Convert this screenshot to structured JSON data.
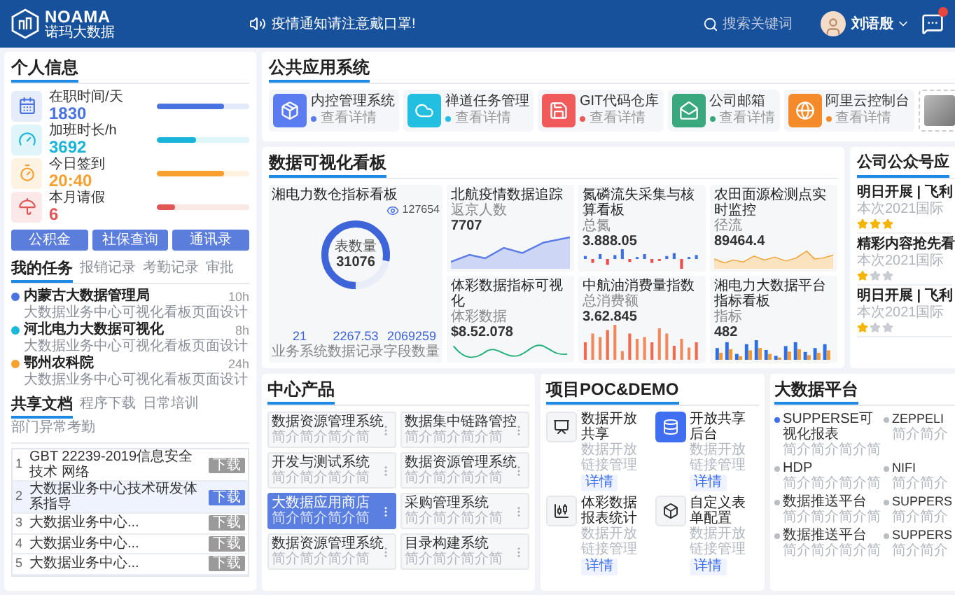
{
  "header": {
    "logo_text": "NOAMA",
    "logo_subtitle": "诺玛大数据",
    "notice": "疫情通知请注意戴口罩!",
    "search": {
      "placeholder": "搜索关键词"
    },
    "user_name": "刘语殷"
  },
  "personal_info": {
    "title": "个人信息",
    "stats": [
      {
        "label": "在职时间/天",
        "value": "1830",
        "level": 0.72,
        "color": "#4a72e0"
      },
      {
        "label": "加班时长/h",
        "value": "3692",
        "level": 0.42,
        "color": "#19b4d8"
      },
      {
        "label": "今日签到",
        "value": "20:40",
        "level": 0.72,
        "color": "#f7a030"
      },
      {
        "label": "本月请假",
        "value": "6",
        "level": 0.2,
        "color": "#e25555"
      }
    ],
    "buttons": [
      "公积金",
      "社保查询",
      "通讯录"
    ]
  },
  "tasks": {
    "tabs": [
      {
        "label": "我的任务",
        "selected": true
      },
      {
        "label": "报销记录",
        "selected": false
      },
      {
        "label": "考勤记录",
        "selected": false
      },
      {
        "label": "审批",
        "selected": false
      }
    ],
    "items": [
      {
        "title": "内蒙古大数据管理局",
        "subtitle": "大数据业务中心可视化看板页面设计",
        "hours": "10h",
        "color": "#4a72e0"
      },
      {
        "title": "河北电力大数据可视化",
        "subtitle": "大数据业务中心可视化看板页面设计",
        "hours": "8h",
        "color": "#19b9db"
      },
      {
        "title": "鄂州农科院",
        "subtitle": "大数据业务中心可视化看板页面设计",
        "hours": "24h",
        "color": "#f7a02c"
      }
    ]
  },
  "docs": {
    "tabs": [
      {
        "label": "共享文档",
        "selected": true
      },
      {
        "label": "程序下载",
        "selected": false
      },
      {
        "label": "日常培训",
        "selected": false
      },
      {
        "label": "部门异常考勤",
        "selected": false
      }
    ],
    "rows": [
      {
        "index": "1",
        "title": "GBT 22239-2019信息安全技术 网络",
        "action": "下载",
        "selected": false
      },
      {
        "index": "2",
        "title": "大数据业务中心技术研发体系指导",
        "action": "下载",
        "selected": true
      },
      {
        "index": "3",
        "title": "大数据业务中心...",
        "action": "下载",
        "selected": false
      },
      {
        "index": "4",
        "title": "大数据业务中心...",
        "action": "下载",
        "selected": false
      },
      {
        "index": "5",
        "title": "大数据业务中心...",
        "action": "下载",
        "selected": false
      }
    ]
  },
  "apps": {
    "title": "公共应用系统",
    "items": [
      {
        "name": "内控管理系统",
        "link": "查看详情",
        "color": "#5b7cf0"
      },
      {
        "name": "禅道任务管理",
        "link": "查看详情",
        "color": "#22bfe0"
      },
      {
        "name": "GIT代码仓库",
        "link": "查看详情",
        "color": "#f05a5a"
      },
      {
        "name": "公司邮箱",
        "link": "查看详情",
        "color": "#3aa87e"
      },
      {
        "name": "阿里云控制台",
        "link": "查看详情",
        "color": "#f58a2a"
      }
    ]
  },
  "board": {
    "title": "数据可视化看板",
    "main_card": {
      "title": "湘电力数仓指标看板",
      "views": "127654",
      "total_label": "表数量",
      "total": "31076",
      "level": 0.78,
      "stats": [
        {
          "value": "21",
          "label": "业务系统"
        },
        {
          "value": "2267.53",
          "label": "数据记录"
        },
        {
          "value": "2069259",
          "label": "字段数量"
        }
      ]
    },
    "cards": [
      {
        "title": "北航疫情数据追踪",
        "metric_label": "返京人数",
        "value": "7707",
        "kind": "area"
      },
      {
        "title": "氮磷流失采集与核算看板",
        "metric_label": "总氮",
        "value": "3.888.05",
        "kind": "split_bars"
      },
      {
        "title": "农田面源检测点实时监控",
        "metric_label": "径流",
        "value": "89464.4",
        "kind": "line"
      },
      {
        "title": "体彩数据指标可视化",
        "metric_label": "体彩数据",
        "value": "$8.52.078",
        "kind": "wave"
      },
      {
        "title": "中航油消费量指数",
        "metric_label": "总消费额",
        "value": "3.62.845",
        "kind": "bars"
      },
      {
        "title": "湘电力大数据平台指标看板",
        "metric_label": "指标",
        "value": "482",
        "kind": "grouped_bars"
      }
    ]
  },
  "notices": {
    "title": "公司公众号应",
    "items": [
      {
        "title": "明日开展 | 飞利",
        "excerpt": "本次2021国际",
        "stars": 3
      },
      {
        "title": "精彩内容抢先看",
        "excerpt": "本次2021国际",
        "stars": 1
      },
      {
        "title": "明日开展 | 飞利",
        "excerpt": "本次2021国际",
        "stars": 1
      }
    ]
  },
  "center_products": {
    "title": "中心产品",
    "items": [
      {
        "name": "数据资源管理系统",
        "caption": "简介简介简介简",
        "selected": false
      },
      {
        "name": "数据集中链路管控",
        "caption": "简介简介简介简",
        "selected": false
      },
      {
        "name": "开发与测试系统",
        "caption": "简介简介简介简",
        "selected": false
      },
      {
        "name": "数据资源管理系统",
        "caption": "简介简介简介简",
        "selected": false
      },
      {
        "name": "大数据应用商店",
        "caption": "简介简介简介简",
        "selected": true
      },
      {
        "name": "采购管理系统",
        "caption": "简介简介简介简",
        "selected": false
      },
      {
        "name": "数据资源管理系统",
        "caption": "简介简介简介简",
        "selected": false
      },
      {
        "name": "目录构建系统",
        "caption": "简介简介简介简",
        "selected": false
      }
    ]
  },
  "poc": {
    "title": "项目POC&DEMO",
    "items": [
      {
        "name": "数据开放共享",
        "caption": "数据开放链接管理",
        "action": "详情",
        "selected": false
      },
      {
        "name": "开放共享后台",
        "caption": "数据开放链接管理",
        "action": "详情",
        "selected": true
      },
      {
        "name": "体彩数据报表统计",
        "caption": "数据开放链接管理",
        "action": "详情",
        "selected": false
      },
      {
        "name": "自定义表单配置",
        "caption": "数据开放链接管理",
        "action": "详情",
        "selected": false
      }
    ]
  },
  "platform": {
    "title": "大数据平台",
    "items": [
      {
        "name": "SUPPERSE可视化报表",
        "caption": "简介简介简介简",
        "selected": true
      },
      {
        "name": "ZEPPELI",
        "caption": "简介简介",
        "selected": false
      },
      {
        "name": "HDP",
        "caption": "简介简介简介简",
        "selected": false
      },
      {
        "name": "NIFI",
        "caption": "简介简介",
        "selected": false
      },
      {
        "name": "数据推送平台",
        "caption": "简介简介简介简",
        "selected": false
      },
      {
        "name": "SUPPERS",
        "caption": "简介简介",
        "selected": false
      },
      {
        "name": "数据推送平台",
        "caption": "简介简介简介简",
        "selected": false
      },
      {
        "name": "SUPPERS",
        "caption": "简介简介",
        "selected": false
      }
    ]
  }
}
